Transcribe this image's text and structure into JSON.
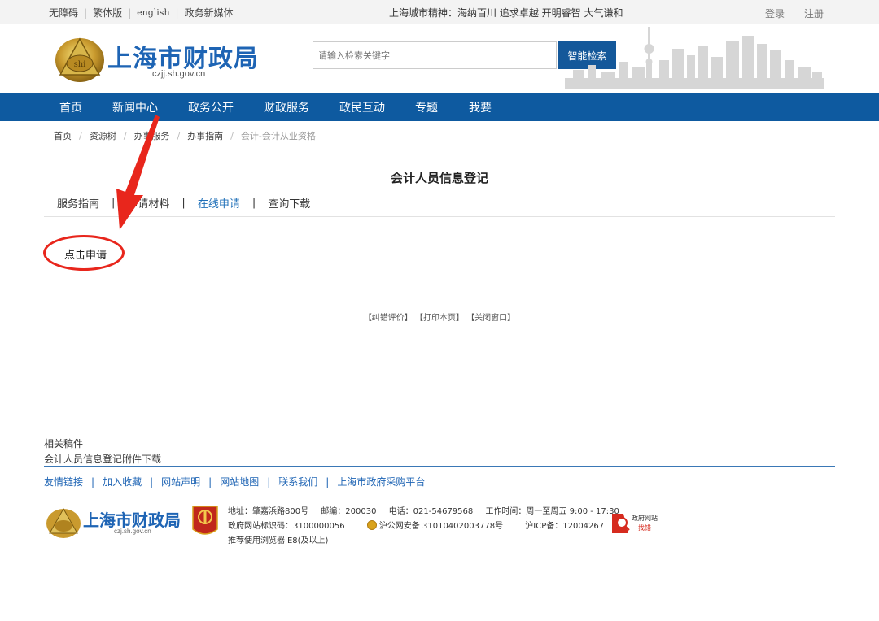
{
  "topbar": {
    "links": [
      "无障碍",
      "繁体版",
      "english",
      "政务新媒体"
    ],
    "motto": "上海城市精神：海纳百川  追求卓越  开明睿智  大气谦和",
    "login": "登录",
    "register": "注册"
  },
  "header": {
    "site_title": "上海市财政局",
    "domain": "czjj.sh.gov.cn",
    "search_placeholder": "请输入检索关键字",
    "search_button": "智能检索"
  },
  "nav": [
    "首页",
    "新闻中心",
    "政务公开",
    "财政服务",
    "政民互动",
    "专题",
    "我要"
  ],
  "breadcrumb": [
    "首页",
    "资源树",
    "办事服务",
    "办事指南",
    "会计-会计从业资格"
  ],
  "page": {
    "title": "会计人员信息登记",
    "tabs": [
      "服务指南",
      "申请材料",
      "在线申请",
      "查询下载"
    ],
    "active_tab": "在线申请",
    "apply_link": "点击申请",
    "actions": [
      "【纠错评价】",
      "【打印本页】",
      "【关闭窗口】"
    ]
  },
  "related": {
    "title": "相关稿件",
    "items": [
      "会计人员信息登记附件下载"
    ]
  },
  "footer": {
    "links": [
      "友情链接",
      "加入收藏",
      "网站声明",
      "网站地图",
      "联系我们",
      "上海市政府采购平台"
    ],
    "site_title": "上海市财政局",
    "domain": "czj.sh.gov.cn",
    "address": "地址：肇嘉浜路800号",
    "postcode": "邮编：200030",
    "phone": "电话：021-54679568",
    "hours": "工作时间：周一至周五 9:00 - 17:30",
    "gov_id": "政府网站标识码：3100000056",
    "police": "沪公网安备 31010402003778号",
    "icp": "沪ICP备：12004267",
    "browser": "推荐使用浏览器IE8(及以上)",
    "error_badge_line1": "政府网站",
    "error_badge_line2": "找错"
  },
  "colors": {
    "nav_blue": "#0e5aa0",
    "link_blue": "#1e64b4",
    "annotation_red": "#e8261c"
  }
}
